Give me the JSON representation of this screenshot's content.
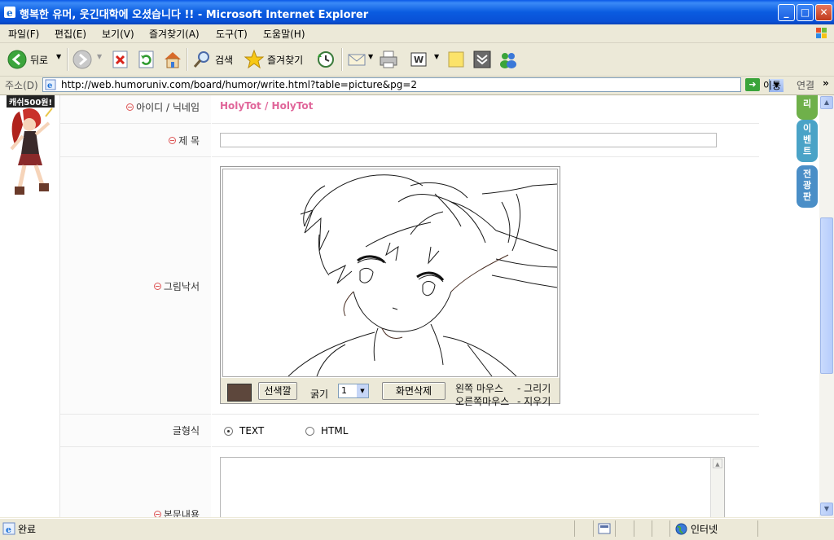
{
  "window": {
    "title": "행복한 유머, 웃긴대학에 오셨습니다 !! - Microsoft Internet Explorer",
    "buttons": {
      "minimize": "_",
      "maximize": "□",
      "close": "✕"
    }
  },
  "menu": [
    "파일(F)",
    "편집(E)",
    "보기(V)",
    "즐겨찾기(A)",
    "도구(T)",
    "도움말(H)"
  ],
  "toolbar": {
    "back": "뒤로",
    "search": "검색",
    "favorites": "즐겨찾기"
  },
  "address": {
    "label": "주소(D)",
    "url": "http://web.humoruniv.com/board/humor/write.html?table=picture&pg=2",
    "go": "이동",
    "links": "연결",
    "chevron": "»"
  },
  "banner": {
    "promo": "캐쉬500원!"
  },
  "form": {
    "id_label": "아이디 / 닉네임",
    "id_value": "HolyTot / HolyTot",
    "title_label": "제 목",
    "drawing_label": "그림낙서",
    "color_button": "선색깔",
    "thickness_label": "굵기",
    "thickness_value": "1",
    "clear_button": "화면삭제",
    "hint_left": "왼쪽 마우스",
    "hint_left_action": "- 그리기",
    "hint_right": "오른쪽마우스",
    "hint_right_action": "- 지우기",
    "format_label": "글형식",
    "format_text": "TEXT",
    "format_html": "HTML",
    "body_label": "본문내용",
    "pen_color": "#5d473c"
  },
  "side_tabs": [
    "리",
    "이벤트",
    "전광판"
  ],
  "status": {
    "text": "완료",
    "zone": "인터넷"
  },
  "colors": {
    "title_bar": "#0a58e8",
    "nick": "#e0669a"
  }
}
